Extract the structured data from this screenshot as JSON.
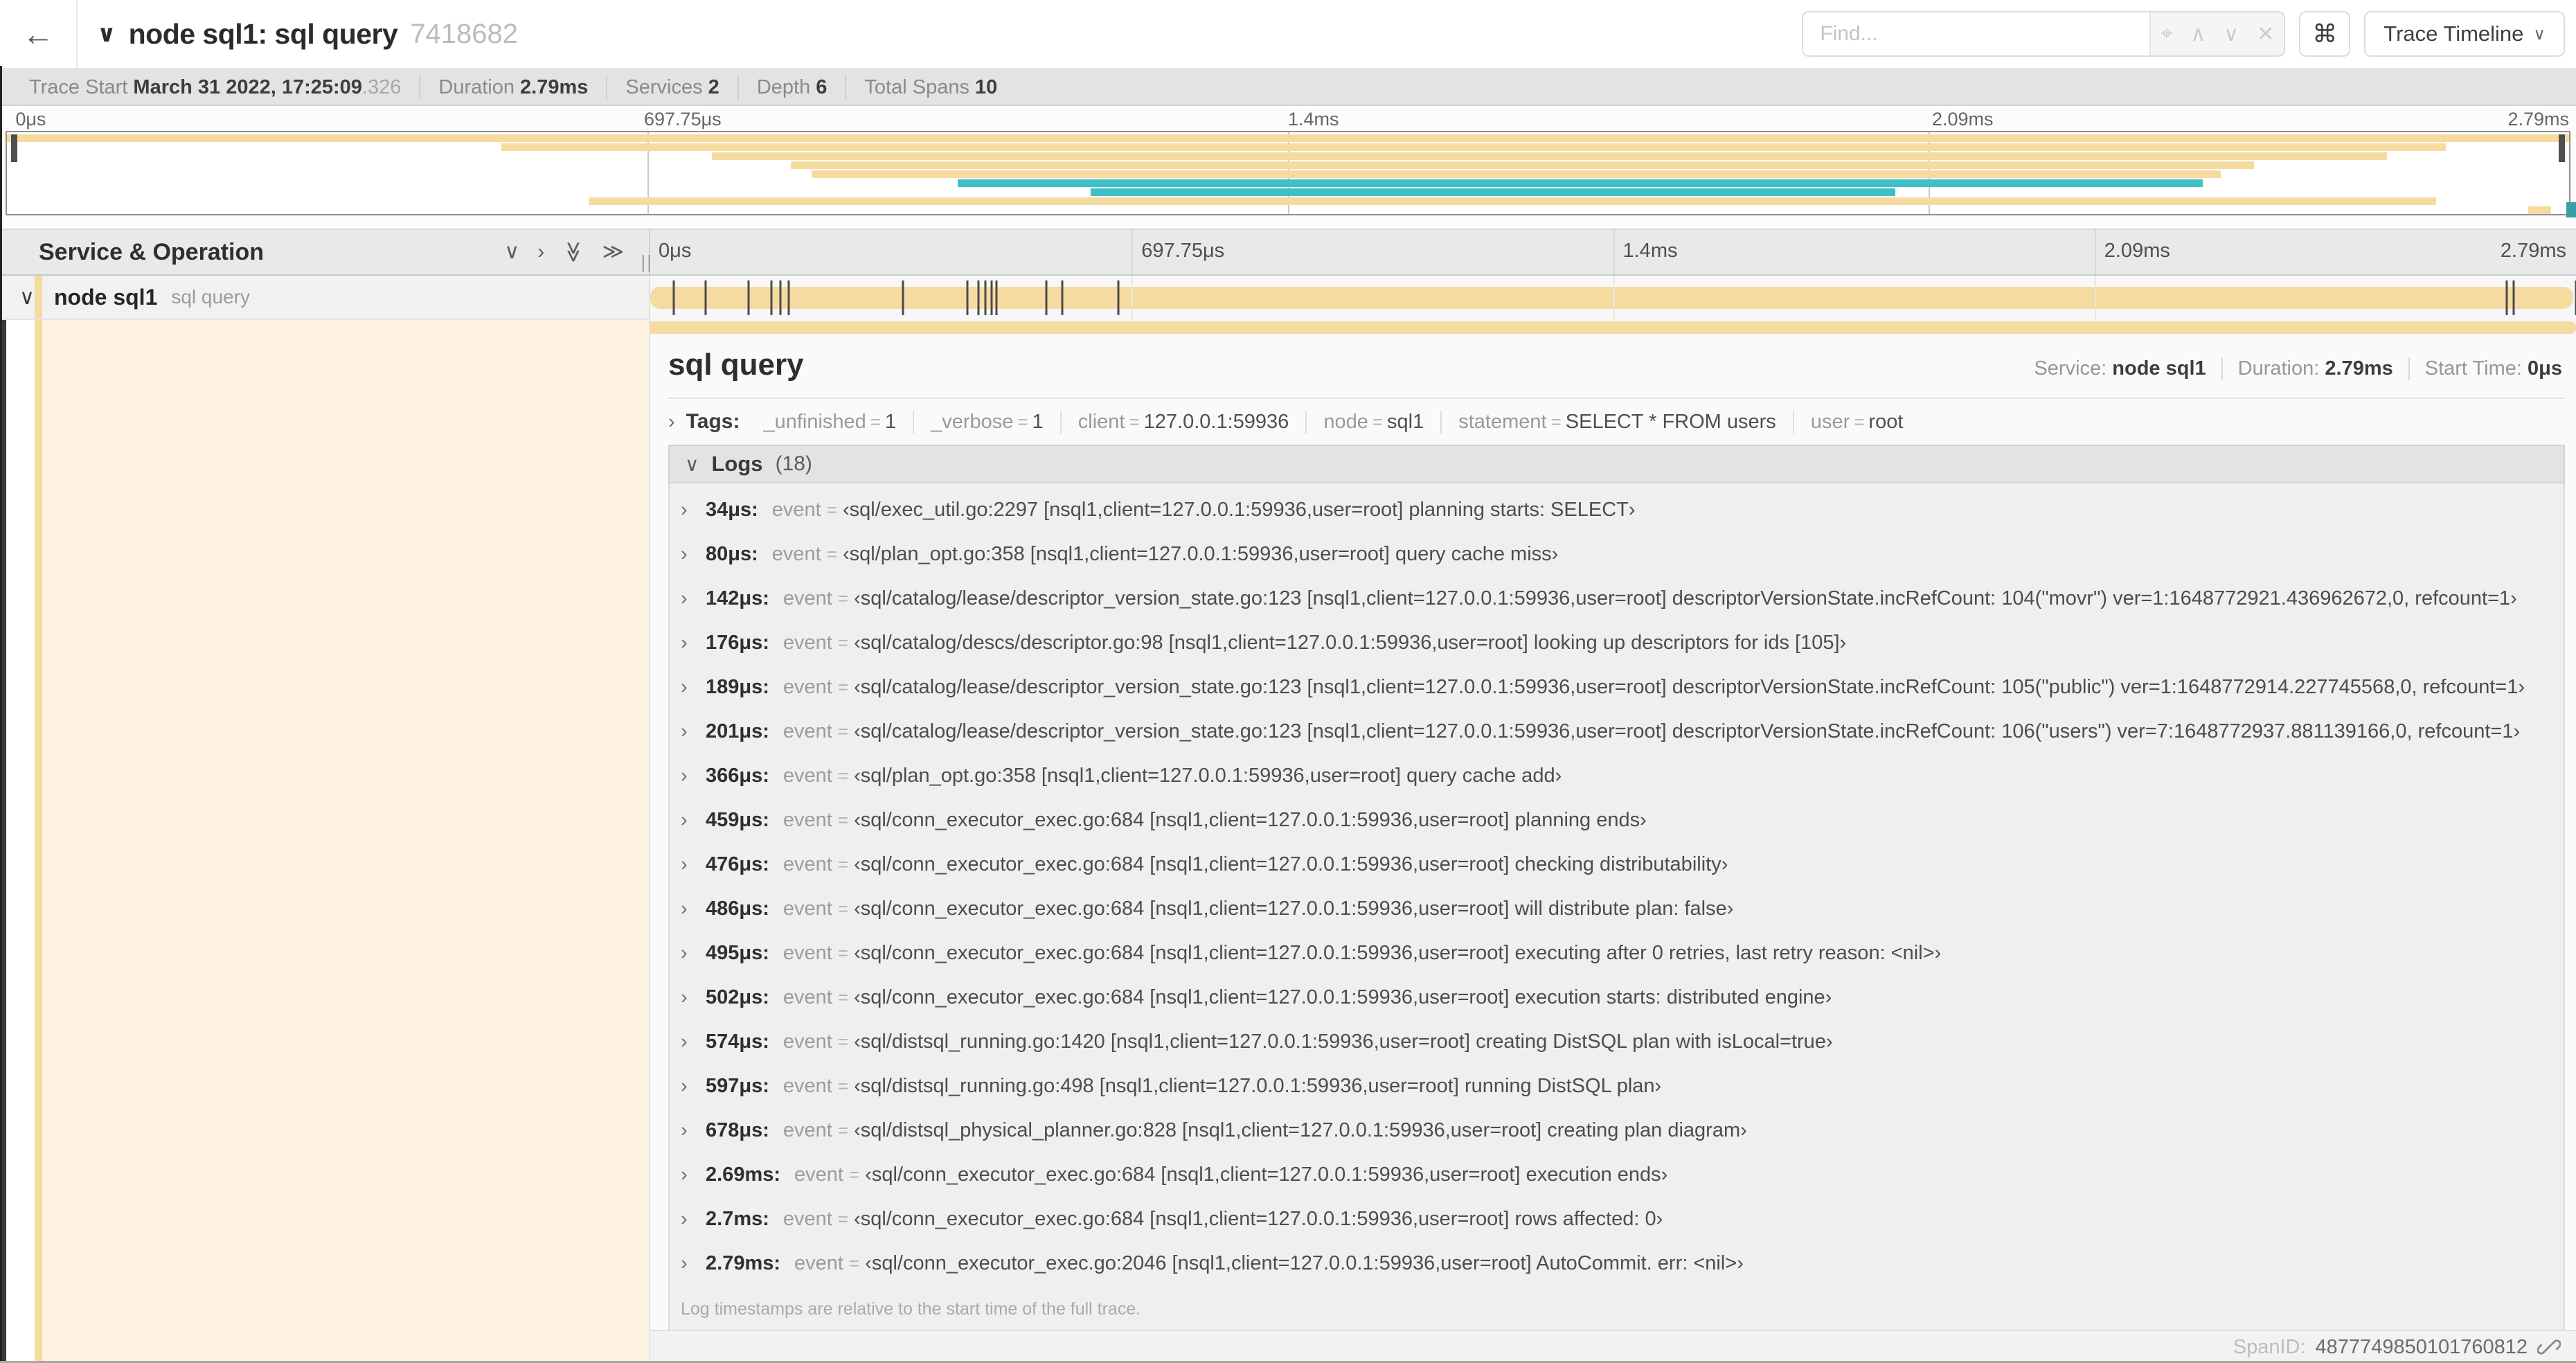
{
  "colors": {
    "khaki": "#f6dba1",
    "khaki_light": "#fdf3e0",
    "teal": "#3fc0c6",
    "tick": "#4b4b4b"
  },
  "icons": {
    "back": "←",
    "chevron_down": "∨",
    "chevron_right": "›",
    "double_chevron": "≫",
    "locate": "⌖",
    "up": "∧",
    "down": "∨",
    "close": "✕",
    "command": "⌘",
    "caret": "⌄"
  },
  "header": {
    "title": "node sql1: sql query",
    "trace_id": "7418682",
    "find_placeholder": "Find...",
    "shortcut_symbol": "⌘",
    "view_label": "Trace Timeline"
  },
  "trace_info": {
    "items": [
      {
        "label": "Trace Start",
        "value": "March 31 2022, 17:25:09",
        "dim": ".326"
      },
      {
        "label": "Duration",
        "value": "2.79ms",
        "dim": ""
      },
      {
        "label": "Services",
        "value": "2",
        "dim": ""
      },
      {
        "label": "Depth",
        "value": "6",
        "dim": ""
      },
      {
        "label": "Total Spans",
        "value": "10",
        "dim": ""
      }
    ]
  },
  "minimap": {
    "labels": [
      "0μs",
      "697.75μs",
      "1.4ms",
      "2.09ms",
      "2.79ms"
    ],
    "bars": [
      {
        "start": 0.0,
        "end": 1.0,
        "color": "khaki"
      },
      {
        "start": 0.193,
        "end": 0.952,
        "color": "khaki"
      },
      {
        "start": 0.275,
        "end": 0.929,
        "color": "khaki"
      },
      {
        "start": 0.306,
        "end": 0.877,
        "color": "khaki"
      },
      {
        "start": 0.314,
        "end": 0.864,
        "color": "khaki"
      },
      {
        "start": 0.371,
        "end": 0.857,
        "color": "teal"
      },
      {
        "start": 0.423,
        "end": 0.737,
        "color": "teal"
      },
      {
        "start": 0.227,
        "end": 0.948,
        "color": "khaki"
      },
      {
        "start": 0.984,
        "end": 0.993,
        "color": "khaki"
      }
    ]
  },
  "timeline": {
    "header_title": "Service & Operation",
    "ruler_labels": [
      "0μs",
      "697.75μs",
      "1.4ms",
      "2.09ms",
      "2.79ms"
    ],
    "total_us": 2790,
    "span_row": {
      "service": "node sql1",
      "operation": "sql query"
    },
    "log_marker_times_us": [
      34,
      80,
      142,
      176,
      189,
      201,
      366,
      459,
      476,
      486,
      495,
      502,
      574,
      597,
      678,
      2690,
      2700,
      2790
    ]
  },
  "detail": {
    "title": "sql query",
    "overview": [
      {
        "label": "Service:",
        "value": "node sql1"
      },
      {
        "label": "Duration:",
        "value": "2.79ms"
      },
      {
        "label": "Start Time:",
        "value": "0μs"
      }
    ],
    "tags_label": "Tags:",
    "tags": [
      {
        "key": "_unfinished",
        "value": "1"
      },
      {
        "key": "_verbose",
        "value": "1"
      },
      {
        "key": "client",
        "value": "127.0.0.1:59936"
      },
      {
        "key": "node",
        "value": "sql1"
      },
      {
        "key": "statement",
        "value": "SELECT * FROM users"
      },
      {
        "key": "user",
        "value": "root"
      }
    ],
    "logs": {
      "title": "Logs",
      "count": "(18)",
      "field_key": "event",
      "quote_open": "‹",
      "quote_close": "›",
      "entries": [
        {
          "time": "34μs",
          "value": "sql/exec_util.go:2297 [nsql1,client=127.0.0.1:59936,user=root] planning starts: SELECT"
        },
        {
          "time": "80μs",
          "value": "sql/plan_opt.go:358 [nsql1,client=127.0.0.1:59936,user=root] query cache miss"
        },
        {
          "time": "142μs",
          "value": "sql/catalog/lease/descriptor_version_state.go:123 [nsql1,client=127.0.0.1:59936,user=root] descriptorVersionState.incRefCount: 104(\"movr\") ver=1:1648772921.436962672,0, refcount=1"
        },
        {
          "time": "176μs",
          "value": "sql/catalog/descs/descriptor.go:98 [nsql1,client=127.0.0.1:59936,user=root] looking up descriptors for ids [105]"
        },
        {
          "time": "189μs",
          "value": "sql/catalog/lease/descriptor_version_state.go:123 [nsql1,client=127.0.0.1:59936,user=root] descriptorVersionState.incRefCount: 105(\"public\") ver=1:1648772914.227745568,0, refcount=1"
        },
        {
          "time": "201μs",
          "value": "sql/catalog/lease/descriptor_version_state.go:123 [nsql1,client=127.0.0.1:59936,user=root] descriptorVersionState.incRefCount: 106(\"users\") ver=7:1648772937.881139166,0, refcount=1"
        },
        {
          "time": "366μs",
          "value": "sql/plan_opt.go:358 [nsql1,client=127.0.0.1:59936,user=root] query cache add"
        },
        {
          "time": "459μs",
          "value": "sql/conn_executor_exec.go:684 [nsql1,client=127.0.0.1:59936,user=root] planning ends"
        },
        {
          "time": "476μs",
          "value": "sql/conn_executor_exec.go:684 [nsql1,client=127.0.0.1:59936,user=root] checking distributability"
        },
        {
          "time": "486μs",
          "value": "sql/conn_executor_exec.go:684 [nsql1,client=127.0.0.1:59936,user=root] will distribute plan: false"
        },
        {
          "time": "495μs",
          "value": "sql/conn_executor_exec.go:684 [nsql1,client=127.0.0.1:59936,user=root] executing after 0 retries, last retry reason: <nil>"
        },
        {
          "time": "502μs",
          "value": "sql/conn_executor_exec.go:684 [nsql1,client=127.0.0.1:59936,user=root] execution starts: distributed engine"
        },
        {
          "time": "574μs",
          "value": "sql/distsql_running.go:1420 [nsql1,client=127.0.0.1:59936,user=root] creating DistSQL plan with isLocal=true"
        },
        {
          "time": "597μs",
          "value": "sql/distsql_running.go:498 [nsql1,client=127.0.0.1:59936,user=root] running DistSQL plan"
        },
        {
          "time": "678μs",
          "value": "sql/distsql_physical_planner.go:828 [nsql1,client=127.0.0.1:59936,user=root] creating plan diagram"
        },
        {
          "time": "2.69ms",
          "value": "sql/conn_executor_exec.go:684 [nsql1,client=127.0.0.1:59936,user=root] execution ends"
        },
        {
          "time": "2.7ms",
          "value": "sql/conn_executor_exec.go:684 [nsql1,client=127.0.0.1:59936,user=root] rows affected: 0"
        },
        {
          "time": "2.79ms",
          "value": "sql/conn_executor_exec.go:2046 [nsql1,client=127.0.0.1:59936,user=root] AutoCommit. err: <nil>"
        }
      ],
      "footnote": "Log timestamps are relative to the start time of the full trace."
    },
    "footer": {
      "spanid_label": "SpanID: ",
      "spanid_value": "4877749850101760812"
    }
  }
}
